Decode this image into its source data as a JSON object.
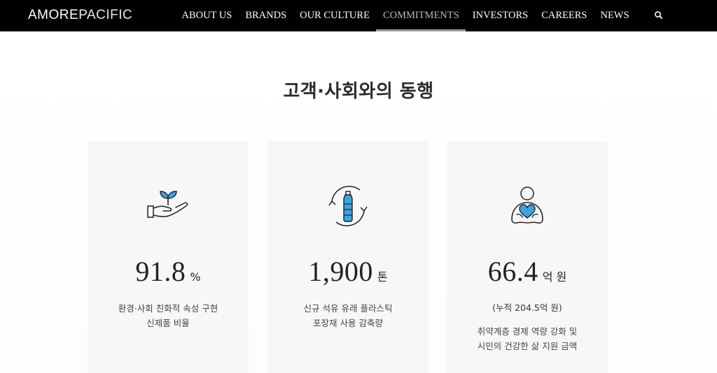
{
  "header": {
    "logo_part1": "AMORE",
    "logo_part2": "PACIFIC",
    "nav": [
      {
        "label": "ABOUT US"
      },
      {
        "label": "BRANDS"
      },
      {
        "label": "OUR CULTURE"
      },
      {
        "label": "COMMITMENTS",
        "active": true
      },
      {
        "label": "INVESTORS"
      },
      {
        "label": "CAREERS"
      },
      {
        "label": "NEWS"
      }
    ],
    "search_icon": "search-icon"
  },
  "main": {
    "title": "고객·사회와의 동행",
    "cards": [
      {
        "icon": "hand-sprout-icon",
        "value": "91.8",
        "unit": "%",
        "desc_line1": "환경·사회 친화적 속성 구현",
        "desc_line2": "신제품 비율"
      },
      {
        "icon": "recycle-bottle-icon",
        "value": "1,900",
        "unit": "톤",
        "desc_line1": "신규 석유 유래 플라스틱",
        "desc_line2": "포장재 사용 감축량"
      },
      {
        "icon": "person-heart-icon",
        "value": "66.4",
        "unit": "억 원",
        "note": "(누적 204.5억 원)",
        "desc_line1": "취약계층 경제 역량 강화 및",
        "desc_line2": "시민의 건강한 삶 지원 금액"
      }
    ]
  },
  "colors": {
    "header_bg": "#000000",
    "card_bg": "#f7f7f7",
    "icon_accent": "#3ba3e0",
    "icon_stroke": "#222222"
  }
}
